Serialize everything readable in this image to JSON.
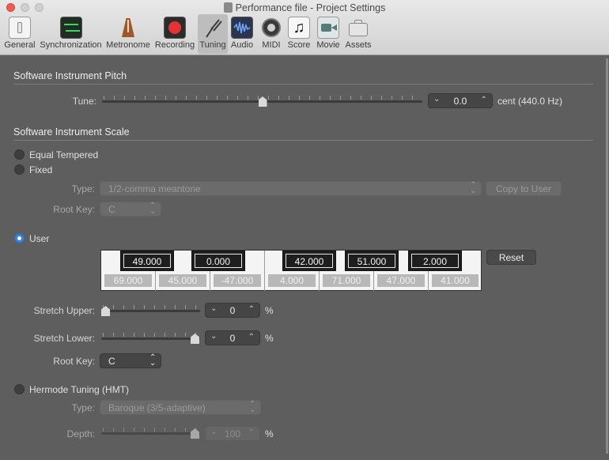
{
  "window": {
    "title": "Performance file - Project Settings"
  },
  "toolbar": {
    "items": [
      {
        "label": "General"
      },
      {
        "label": "Synchronization"
      },
      {
        "label": "Metronome"
      },
      {
        "label": "Recording"
      },
      {
        "label": "Tuning"
      },
      {
        "label": "Audio"
      },
      {
        "label": "MIDI"
      },
      {
        "label": "Score"
      },
      {
        "label": "Movie"
      },
      {
        "label": "Assets"
      }
    ],
    "selected": "Tuning"
  },
  "pitch": {
    "section_title": "Software Instrument Pitch",
    "tune_label": "Tune:",
    "tune_value": "0.0",
    "tune_unit": "cent  (440.0 Hz)"
  },
  "scale": {
    "section_title": "Software Instrument Scale",
    "equal_tempered_label": "Equal Tempered",
    "fixed_label": "Fixed",
    "type_label": "Type:",
    "type_value": "1/2-comma meantone",
    "copy_to_user_label": "Copy to User",
    "root_key_label": "Root Key:",
    "root_key_value": "C",
    "user_label": "User",
    "selected_mode": "User",
    "white_keys": [
      "69.000",
      "45.000",
      "-47.000",
      "4.000",
      "71.000",
      "47.000",
      "41.000"
    ],
    "black_keys": [
      "49.000",
      "0.000",
      "42.000",
      "51.000",
      "2.000"
    ],
    "reset_label": "Reset",
    "stretch_upper_label": "Stretch Upper:",
    "stretch_upper_value": "0",
    "stretch_lower_label": "Stretch Lower:",
    "stretch_lower_value": "0",
    "percent": "%",
    "user_root_key_label": "Root Key:",
    "user_root_key_value": "C"
  },
  "hermode": {
    "label": "Hermode Tuning (HMT)",
    "type_label": "Type:",
    "type_value": "Baroque (3/5-adaptive)",
    "depth_label": "Depth:",
    "depth_value": "100",
    "percent": "%"
  }
}
